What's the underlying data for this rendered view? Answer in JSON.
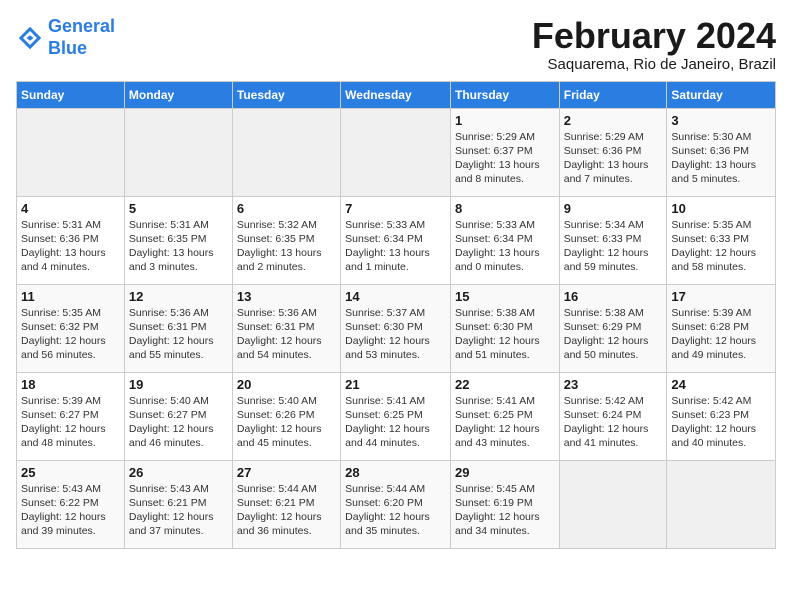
{
  "logo": {
    "line1": "General",
    "line2": "Blue"
  },
  "header": {
    "month_year": "February 2024",
    "location": "Saquarema, Rio de Janeiro, Brazil"
  },
  "weekdays": [
    "Sunday",
    "Monday",
    "Tuesday",
    "Wednesday",
    "Thursday",
    "Friday",
    "Saturday"
  ],
  "weeks": [
    [
      {
        "day": "",
        "text": ""
      },
      {
        "day": "",
        "text": ""
      },
      {
        "day": "",
        "text": ""
      },
      {
        "day": "",
        "text": ""
      },
      {
        "day": "1",
        "text": "Sunrise: 5:29 AM\nSunset: 6:37 PM\nDaylight: 13 hours\nand 8 minutes."
      },
      {
        "day": "2",
        "text": "Sunrise: 5:29 AM\nSunset: 6:36 PM\nDaylight: 13 hours\nand 7 minutes."
      },
      {
        "day": "3",
        "text": "Sunrise: 5:30 AM\nSunset: 6:36 PM\nDaylight: 13 hours\nand 5 minutes."
      }
    ],
    [
      {
        "day": "4",
        "text": "Sunrise: 5:31 AM\nSunset: 6:36 PM\nDaylight: 13 hours\nand 4 minutes."
      },
      {
        "day": "5",
        "text": "Sunrise: 5:31 AM\nSunset: 6:35 PM\nDaylight: 13 hours\nand 3 minutes."
      },
      {
        "day": "6",
        "text": "Sunrise: 5:32 AM\nSunset: 6:35 PM\nDaylight: 13 hours\nand 2 minutes."
      },
      {
        "day": "7",
        "text": "Sunrise: 5:33 AM\nSunset: 6:34 PM\nDaylight: 13 hours\nand 1 minute."
      },
      {
        "day": "8",
        "text": "Sunrise: 5:33 AM\nSunset: 6:34 PM\nDaylight: 13 hours\nand 0 minutes."
      },
      {
        "day": "9",
        "text": "Sunrise: 5:34 AM\nSunset: 6:33 PM\nDaylight: 12 hours\nand 59 minutes."
      },
      {
        "day": "10",
        "text": "Sunrise: 5:35 AM\nSunset: 6:33 PM\nDaylight: 12 hours\nand 58 minutes."
      }
    ],
    [
      {
        "day": "11",
        "text": "Sunrise: 5:35 AM\nSunset: 6:32 PM\nDaylight: 12 hours\nand 56 minutes."
      },
      {
        "day": "12",
        "text": "Sunrise: 5:36 AM\nSunset: 6:31 PM\nDaylight: 12 hours\nand 55 minutes."
      },
      {
        "day": "13",
        "text": "Sunrise: 5:36 AM\nSunset: 6:31 PM\nDaylight: 12 hours\nand 54 minutes."
      },
      {
        "day": "14",
        "text": "Sunrise: 5:37 AM\nSunset: 6:30 PM\nDaylight: 12 hours\nand 53 minutes."
      },
      {
        "day": "15",
        "text": "Sunrise: 5:38 AM\nSunset: 6:30 PM\nDaylight: 12 hours\nand 51 minutes."
      },
      {
        "day": "16",
        "text": "Sunrise: 5:38 AM\nSunset: 6:29 PM\nDaylight: 12 hours\nand 50 minutes."
      },
      {
        "day": "17",
        "text": "Sunrise: 5:39 AM\nSunset: 6:28 PM\nDaylight: 12 hours\nand 49 minutes."
      }
    ],
    [
      {
        "day": "18",
        "text": "Sunrise: 5:39 AM\nSunset: 6:27 PM\nDaylight: 12 hours\nand 48 minutes."
      },
      {
        "day": "19",
        "text": "Sunrise: 5:40 AM\nSunset: 6:27 PM\nDaylight: 12 hours\nand 46 minutes."
      },
      {
        "day": "20",
        "text": "Sunrise: 5:40 AM\nSunset: 6:26 PM\nDaylight: 12 hours\nand 45 minutes."
      },
      {
        "day": "21",
        "text": "Sunrise: 5:41 AM\nSunset: 6:25 PM\nDaylight: 12 hours\nand 44 minutes."
      },
      {
        "day": "22",
        "text": "Sunrise: 5:41 AM\nSunset: 6:25 PM\nDaylight: 12 hours\nand 43 minutes."
      },
      {
        "day": "23",
        "text": "Sunrise: 5:42 AM\nSunset: 6:24 PM\nDaylight: 12 hours\nand 41 minutes."
      },
      {
        "day": "24",
        "text": "Sunrise: 5:42 AM\nSunset: 6:23 PM\nDaylight: 12 hours\nand 40 minutes."
      }
    ],
    [
      {
        "day": "25",
        "text": "Sunrise: 5:43 AM\nSunset: 6:22 PM\nDaylight: 12 hours\nand 39 minutes."
      },
      {
        "day": "26",
        "text": "Sunrise: 5:43 AM\nSunset: 6:21 PM\nDaylight: 12 hours\nand 37 minutes."
      },
      {
        "day": "27",
        "text": "Sunrise: 5:44 AM\nSunset: 6:21 PM\nDaylight: 12 hours\nand 36 minutes."
      },
      {
        "day": "28",
        "text": "Sunrise: 5:44 AM\nSunset: 6:20 PM\nDaylight: 12 hours\nand 35 minutes."
      },
      {
        "day": "29",
        "text": "Sunrise: 5:45 AM\nSunset: 6:19 PM\nDaylight: 12 hours\nand 34 minutes."
      },
      {
        "day": "",
        "text": ""
      },
      {
        "day": "",
        "text": ""
      }
    ]
  ]
}
